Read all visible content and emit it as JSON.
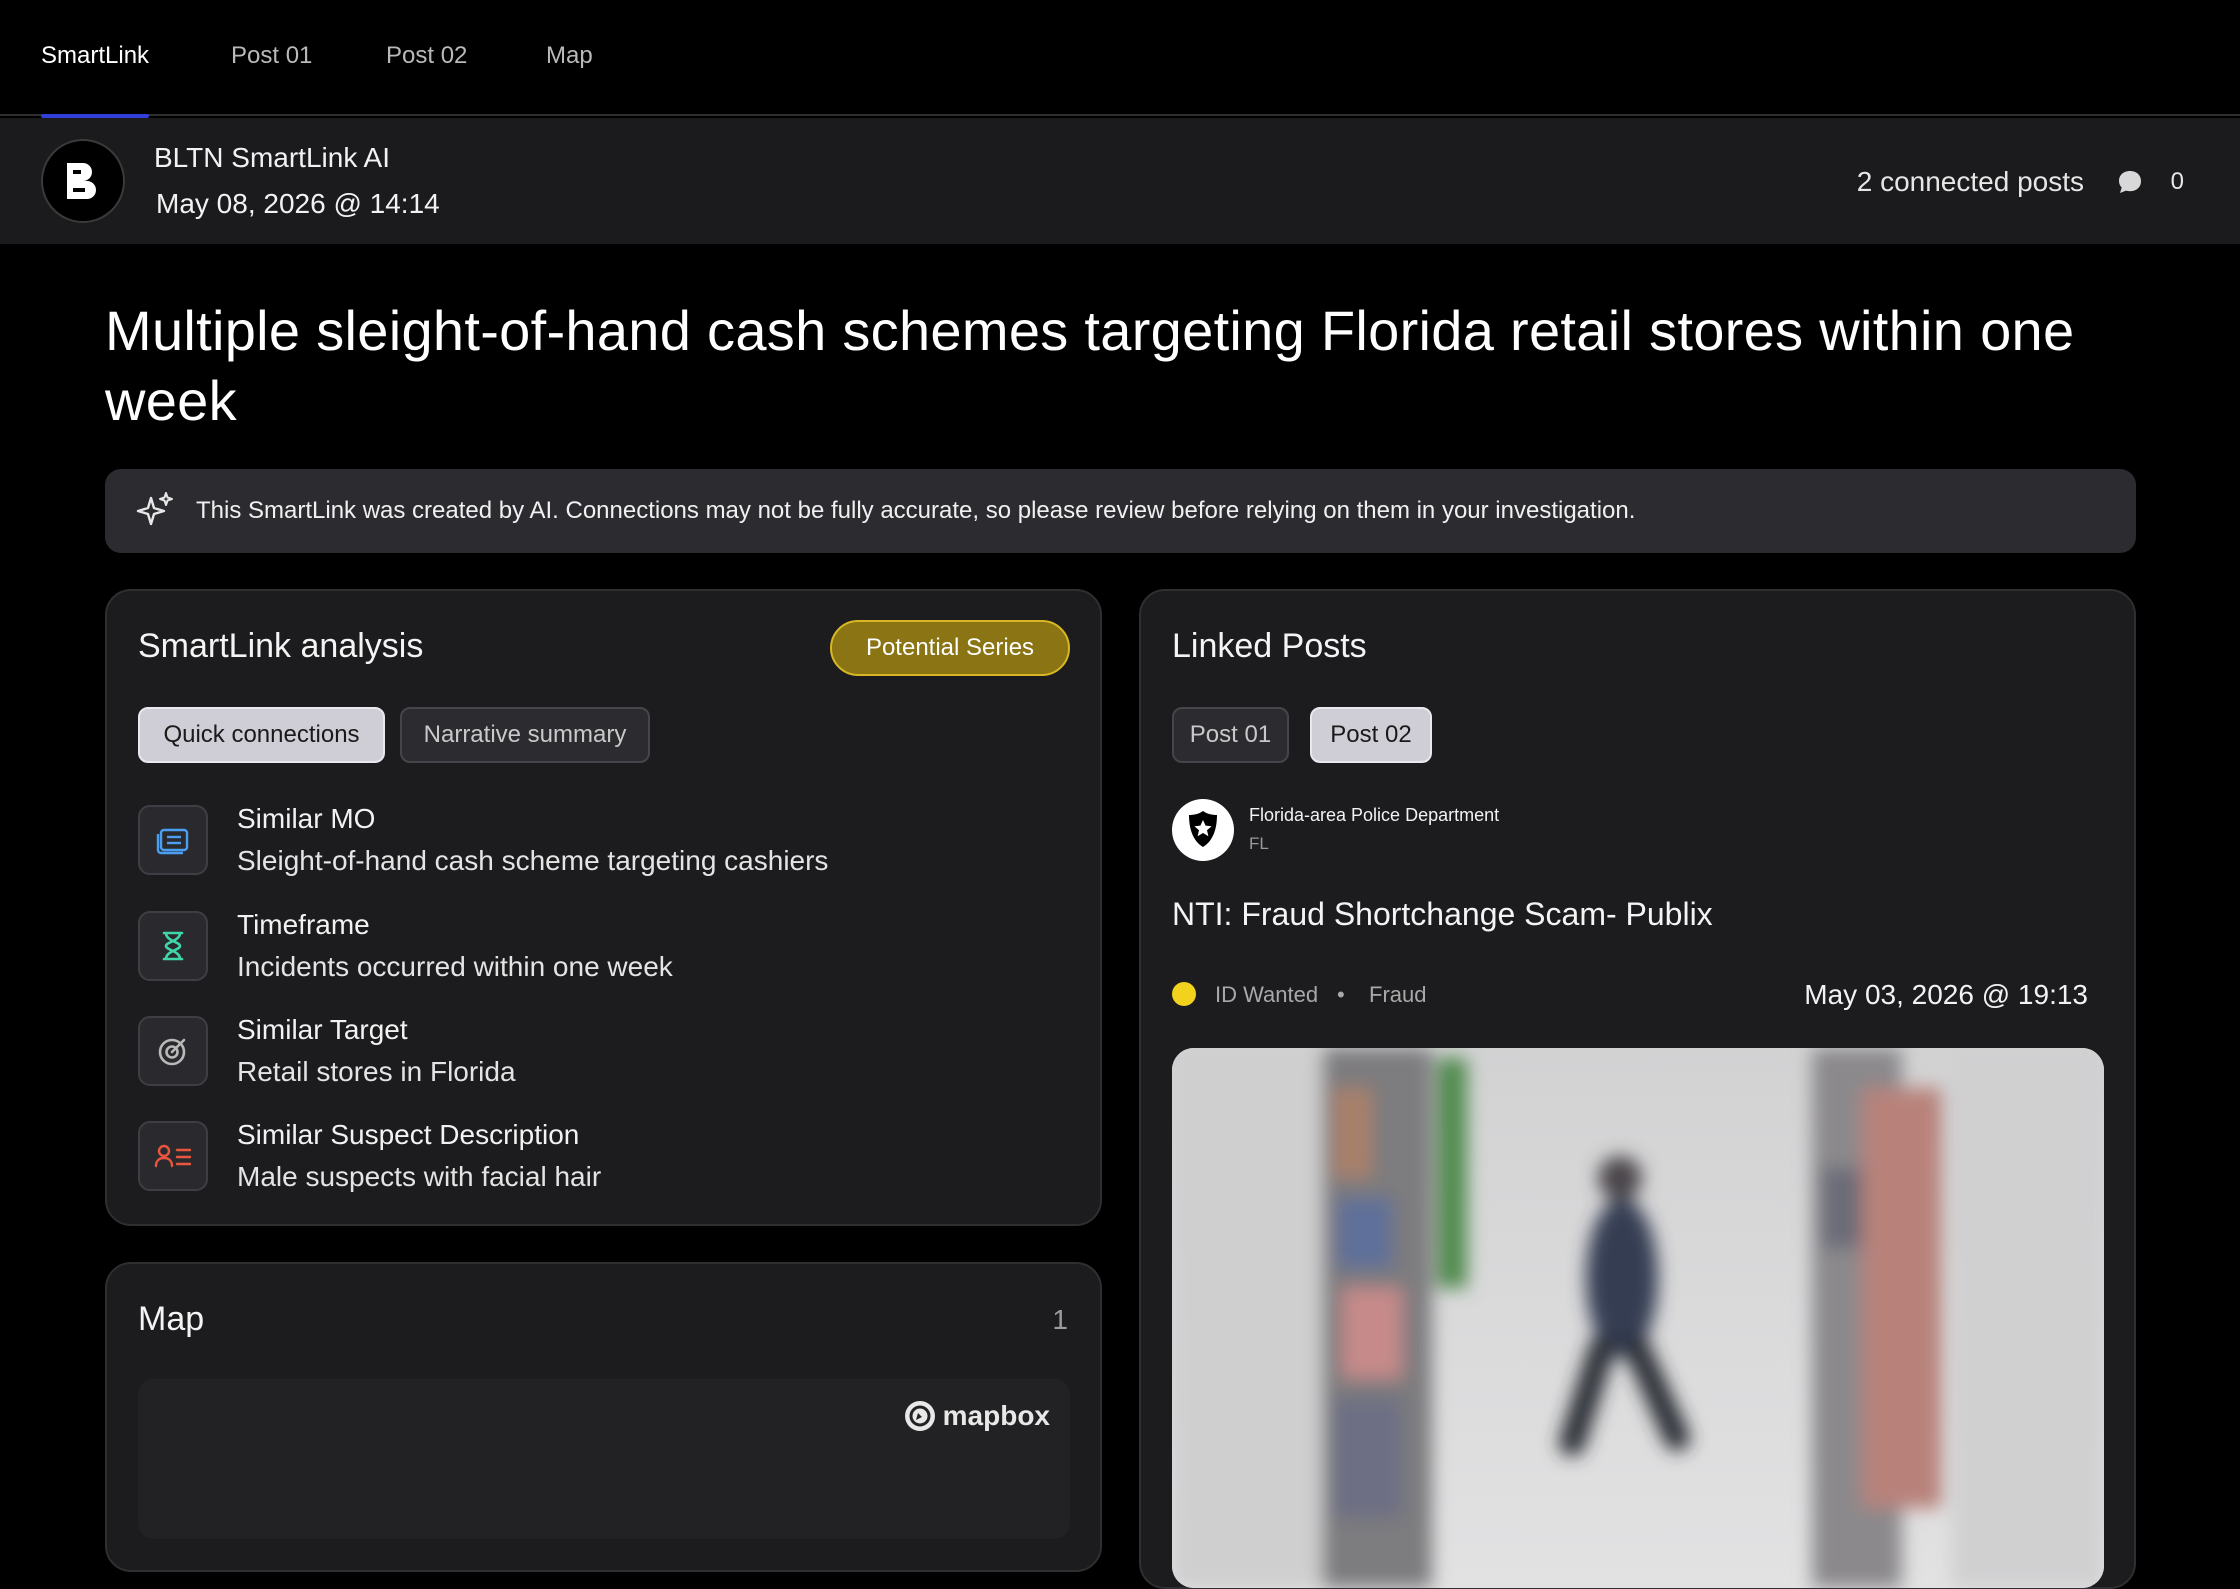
{
  "nav": {
    "tabs": [
      {
        "label": "SmartLink",
        "active": true
      },
      {
        "label": "Post 01",
        "active": false
      },
      {
        "label": "Post 02",
        "active": false
      },
      {
        "label": "Map",
        "active": false
      }
    ]
  },
  "header": {
    "logo_letter": "B",
    "author": "BLTN SmartLink AI",
    "date": "May 08, 2026 @ 14:14",
    "connected_posts": "2 connected posts",
    "comment_count": "0"
  },
  "page": {
    "title": "Multiple sleight-of-hand cash schemes targeting Florida retail stores within one week"
  },
  "disclaimer": {
    "icon": "sparkle-icon",
    "text": "This SmartLink was created by AI. Connections may not be fully accurate, so please review before relying on them in your investigation."
  },
  "analysis": {
    "title": "SmartLink analysis",
    "badge": "Potential Series",
    "badge_color": "#8a7414",
    "tabs": [
      {
        "label": "Quick connections",
        "active": true
      },
      {
        "label": "Narrative summary",
        "active": false
      }
    ],
    "connections": [
      {
        "icon": "list-card-icon",
        "color": "#4a9ff2",
        "title": "Similar MO",
        "desc": "Sleight-of-hand cash scheme targeting cashiers"
      },
      {
        "icon": "hourglass-icon",
        "color": "#3fd6a8",
        "title": "Timeframe",
        "desc": "Incidents occurred within one week"
      },
      {
        "icon": "target-icon",
        "color": "#b9b9b9",
        "title": "Similar Target",
        "desc": "Retail stores in Florida"
      },
      {
        "icon": "person-list-icon",
        "color": "#e8563f",
        "title": "Similar Suspect Description",
        "desc": "Male suspects with facial hair"
      }
    ]
  },
  "map": {
    "title": "Map",
    "count": "1",
    "attribution": "mapbox"
  },
  "linked": {
    "title": "Linked Posts",
    "tabs": [
      {
        "label": "Post 01",
        "active": false
      },
      {
        "label": "Post 02",
        "active": true
      }
    ],
    "post": {
      "agency": "Florida-area Police Department",
      "state": "FL",
      "title": "NTI: Fraud Shortchange Scam- Publix",
      "status": "ID Wanted",
      "status_color": "#f2d21c",
      "separator": "•",
      "category": "Fraud",
      "date": "May 03, 2026 @ 19:13"
    }
  }
}
